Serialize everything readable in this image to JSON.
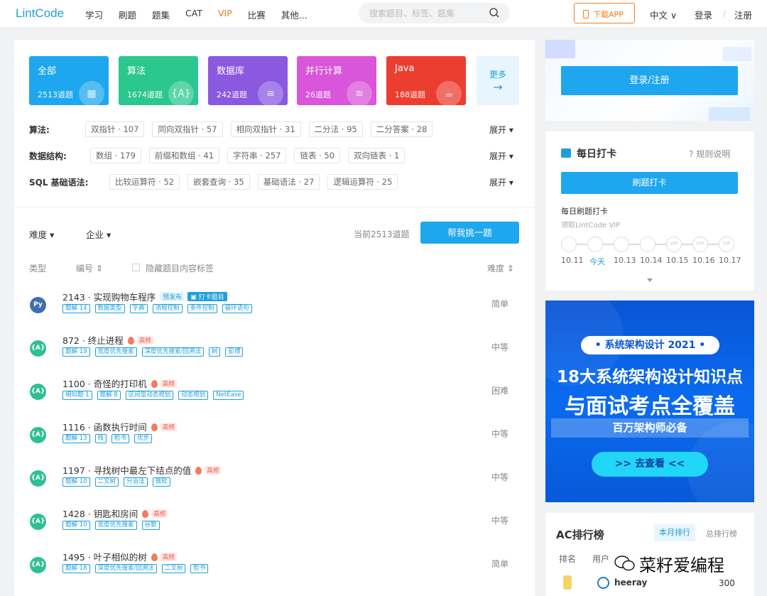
{
  "header": {
    "logo": "LintCode",
    "nav": [
      "学习",
      "刷题",
      "题集",
      "CAT",
      "VIP",
      "比赛",
      "其他..."
    ],
    "search_placeholder": "搜索题目、标签、题集",
    "app_button": "下载APP",
    "lang": "中文",
    "login": "登录",
    "register": "注册"
  },
  "categories": [
    {
      "name": "全部",
      "count": "2513道题",
      "color": "#1ea7ee"
    },
    {
      "name": "算法",
      "count": "1674道题",
      "color": "#2bc78f"
    },
    {
      "name": "数据库",
      "count": "242道题",
      "color": "#8b58e0"
    },
    {
      "name": "并行计算",
      "count": "26道题",
      "color": "#d955d9"
    },
    {
      "name": "Java",
      "count": "188道题",
      "color": "#ec3e30"
    }
  ],
  "more": "更多",
  "tag_rows": [
    {
      "label": "算法:",
      "tags": [
        "双指针 · 107",
        "同向双指针 · 57",
        "相向双指针 · 31",
        "二分法 · 95",
        "二分答案 · 28"
      ]
    },
    {
      "label": "数据结构:",
      "tags": [
        "数组 · 179",
        "前缀和数组 · 41",
        "字符串 · 257",
        "链表 · 50",
        "双向链表 · 1"
      ]
    },
    {
      "label": "SQL 基础语法:",
      "tags": [
        "比较运算符 · 52",
        "嵌套查询 · 35",
        "基础语法 · 27",
        "逻辑运算符 · 25"
      ]
    }
  ],
  "expand_label": "展开",
  "filters": {
    "difficulty": "难度",
    "company": "企业",
    "count_text": "当前2513道题",
    "pick_button": "帮我挑一题"
  },
  "table_head": {
    "type": "类型",
    "number": "编号",
    "hide_tags": "隐藏题目内容标签",
    "difficulty": "难度"
  },
  "problems": [
    {
      "title": "2143 · 实现购物车程序",
      "badges": [
        "预发布",
        "打卡题目"
      ],
      "chips": [
        "题解·14",
        "数据类型",
        "字典",
        "流程控制",
        "条件控制",
        "循环语句"
      ],
      "difficulty": "简单",
      "icon": "python"
    },
    {
      "title": "872 · 终止进程",
      "badges": [
        "高频"
      ],
      "chips": [
        "题解·19",
        "宽度优先搜索",
        "深度优先搜索/回溯法",
        "树",
        "彭博"
      ],
      "difficulty": "中等",
      "icon": "algo"
    },
    {
      "title": "1100 · 奇怪的打印机",
      "badges": [
        "高频"
      ],
      "chips": [
        "相似题·1",
        "题解·8",
        "区间型动态规划",
        "动态规划",
        "NetEase"
      ],
      "difficulty": "困难",
      "icon": "algo"
    },
    {
      "title": "1116 · 函数执行时间",
      "badges": [
        "高频"
      ],
      "chips": [
        "题解·13",
        "栈",
        "脸书",
        "优步"
      ],
      "difficulty": "中等",
      "icon": "algo"
    },
    {
      "title": "1197 · 寻找树中最左下结点的值",
      "badges": [
        "高频"
      ],
      "chips": [
        "题解·10",
        "二叉树",
        "分治法",
        "微软"
      ],
      "difficulty": "中等",
      "icon": "algo"
    },
    {
      "title": "1428 · 钥匙和房间",
      "badges": [
        "高频"
      ],
      "chips": [
        "题解·10",
        "宽度优先搜索",
        "谷歌"
      ],
      "difficulty": "中等",
      "icon": "algo"
    },
    {
      "title": "1495 · 叶子相似的树",
      "badges": [
        "高频"
      ],
      "chips": [
        "题解·18",
        "深度优先搜索/回溯法",
        "二叉树",
        "脸书"
      ],
      "difficulty": "简单",
      "icon": "algo"
    }
  ],
  "login_card": {
    "button": "登录/注册"
  },
  "checkin": {
    "title": "每日打卡",
    "rules": "规则说明",
    "button": "刷题打卡",
    "line1": "每日刷题打卡",
    "line2": "领取LintCode VIP",
    "vip": "VIP",
    "dates": [
      "10.11",
      "今天",
      "10.13",
      "10.14",
      "10.15",
      "10.16",
      "10.17"
    ]
  },
  "banner": {
    "tag": "• 系统架构设计 2021 •",
    "line1": "18大系统架构设计知识点",
    "line2": "与面试考点全覆盖",
    "line3": "百万架构师必备",
    "button": ">> 去查看 <<"
  },
  "ranking": {
    "title": "AC排行榜",
    "tab_month": "本月排行",
    "tab_all": "总排行榜",
    "col_rank": "排名",
    "col_user": "用户",
    "user": "heeray",
    "score": "300"
  },
  "watermark": "菜籽爱编程"
}
